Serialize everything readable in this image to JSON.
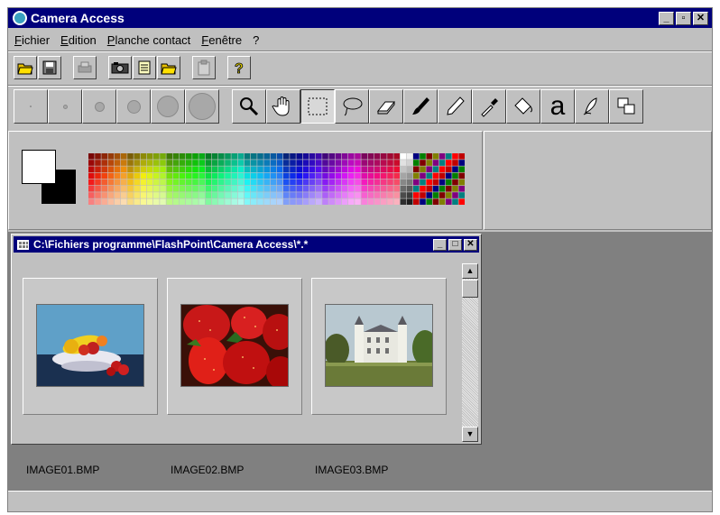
{
  "app": {
    "title": "Camera Access",
    "window_controls": [
      "_",
      "▫",
      "✕"
    ]
  },
  "menu": [
    "Fichier",
    "Edition",
    "Planche contact",
    "Fenêtre",
    "?"
  ],
  "toolbar_main": [
    {
      "icon": "open-folder-icon"
    },
    {
      "icon": "save-disk-icon"
    },
    {
      "icon": "print-icon"
    },
    {
      "icon": "camera-icon"
    },
    {
      "icon": "notepad-icon"
    },
    {
      "icon": "open-folder-2-icon"
    },
    {
      "icon": "clipboard-icon"
    },
    {
      "icon": "help-icon"
    }
  ],
  "toolbar_tools": {
    "brush_sizes": [
      "brush-size-1-icon",
      "brush-size-2-icon",
      "brush-size-3-icon",
      "brush-size-4-icon",
      "brush-size-5-icon",
      "brush-size-6-icon"
    ],
    "tools": [
      "zoom-icon",
      "hand-icon",
      "rect-select-icon",
      "lasso-icon",
      "eraser-icon",
      "brush-icon",
      "pencil-icon",
      "eyedropper-icon",
      "paint-bucket-icon",
      "text-tool-icon",
      "smudge-icon",
      "clone-icon"
    ],
    "text_tool_glyph": "a",
    "selected_tool": "rect-select-icon"
  },
  "colors": {
    "foreground": "#ffffff",
    "background": "#000000",
    "title_bar": "#00007b"
  },
  "child_window": {
    "title": "C:\\Fichiers programme\\FlashPoint\\Camera Access\\*.*",
    "controls": [
      "_",
      "□",
      "✕"
    ],
    "thumbnails": [
      {
        "label": "IMAGE01.BMP"
      },
      {
        "label": "IMAGE02.BMP"
      },
      {
        "label": "IMAGE03.BMP"
      }
    ]
  }
}
